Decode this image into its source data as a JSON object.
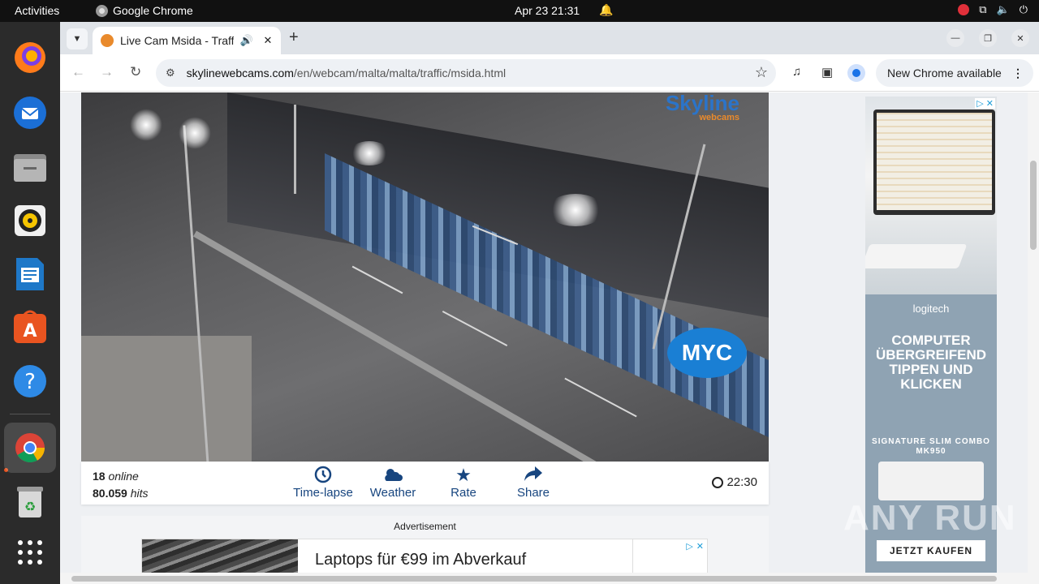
{
  "system": {
    "activities": "Activities",
    "app_name": "Google Chrome",
    "datetime": "Apr 23  21:31"
  },
  "dock": {
    "items": [
      "firefox-icon",
      "thunderbird-icon",
      "files-icon",
      "rhythmbox-icon",
      "writer-icon",
      "app-center-icon",
      "help-icon",
      "chrome-icon",
      "trash-icon",
      "apps-grid-icon"
    ]
  },
  "browser": {
    "tab_title": "Live Cam Msida - Traffi",
    "url_domain": "skylinewebcams.com",
    "url_path": "/en/webcam/malta/malta/traffic/msida.html",
    "update_label": "New Chrome available"
  },
  "camera": {
    "brand": "Skyline",
    "brand_sub": "webcams",
    "overlay_logo": "MYC"
  },
  "stats": {
    "online_count": "18",
    "online_label": "online",
    "hits_count": "80.059",
    "hits_label": "hits"
  },
  "actions": [
    {
      "label": "Time-lapse"
    },
    {
      "label": "Weather"
    },
    {
      "label": "Rate"
    },
    {
      "label": "Share"
    }
  ],
  "clock_time": "22:30",
  "ad": {
    "label": "Advertisement",
    "banner_text": "Laptops für €99 im Abverkauf"
  },
  "side_ad": {
    "brand": "logitech",
    "headline": "COMPUTER ÜBERGREIFEND TIPPEN UND KLICKEN",
    "product": "SIGNATURE SLIM COMBO MK950",
    "cta": "JETZT KAUFEN"
  },
  "watermark": "ANY RUN"
}
